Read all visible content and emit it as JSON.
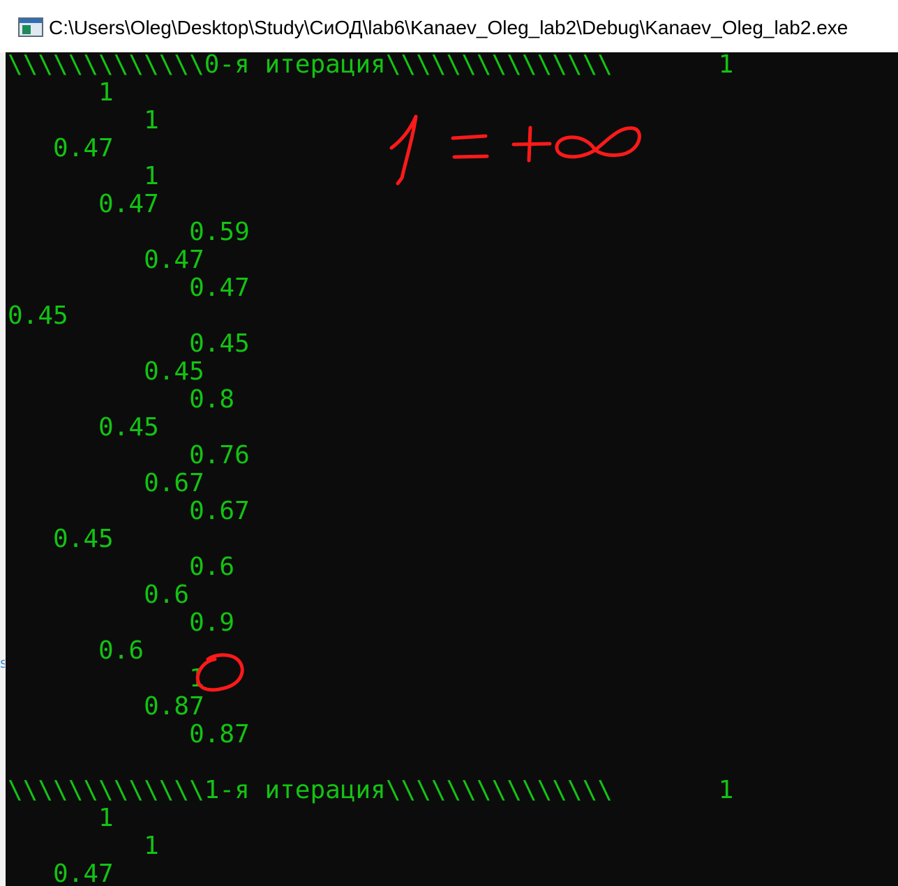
{
  "window": {
    "title": "C:\\Users\\Oleg\\Desktop\\Study\\СиОД\\lab6\\Kanaev_Oleg_lab2\\Debug\\Kanaev_Oleg_lab2.exe",
    "icon": "console-app-icon"
  },
  "colors": {
    "console_background": "#0c0c0c",
    "console_text": "#13c313",
    "annotation": "#ff1a1a"
  },
  "console": {
    "lines": [
      "\\\\\\\\\\\\\\\\\\\\\\\\\\0-я итерация\\\\\\\\\\\\\\\\\\\\\\\\\\\\\\       1",
      "      1",
      "         1",
      "   0.47",
      "         1",
      "      0.47",
      "            0.59",
      "         0.47",
      "            0.47",
      "0.45",
      "            0.45",
      "         0.45",
      "            0.8",
      "      0.45",
      "            0.76",
      "         0.67",
      "            0.67",
      "   0.45",
      "            0.6",
      "         0.6",
      "            0.9",
      "      0.6",
      "            1",
      "         0.87",
      "            0.87",
      "",
      "\\\\\\\\\\\\\\\\\\\\\\\\\\1-я итерация\\\\\\\\\\\\\\\\\\\\\\\\\\\\\\       1",
      "      1",
      "         1",
      "   0.47"
    ]
  },
  "annotations": {
    "handwritten_note": "1 = +∞"
  }
}
